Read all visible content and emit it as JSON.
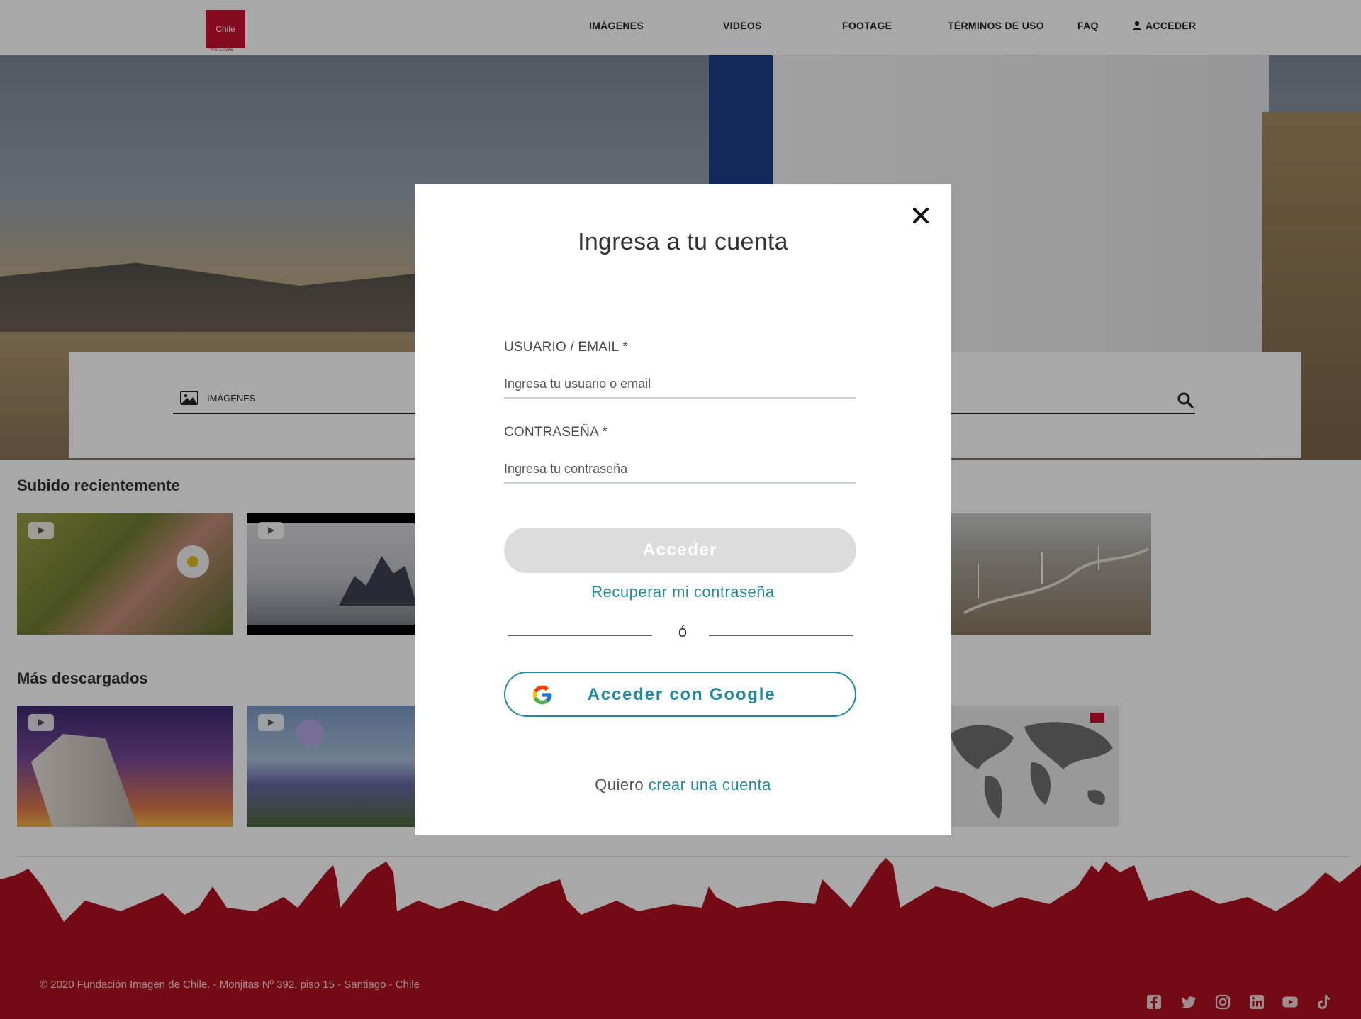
{
  "header": {
    "logo_text": "Chile",
    "logo_tagline": "WE CARE",
    "nav": [
      {
        "label": "IMÁGENES"
      },
      {
        "label": "VIDEOS"
      },
      {
        "label": "FOOTAGE"
      },
      {
        "label": "TÉRMINOS DE USO"
      },
      {
        "label": "FAQ"
      },
      {
        "label": "ACCEDER",
        "icon": "user-icon"
      }
    ]
  },
  "search": {
    "type_label": "IMÁGENES",
    "type_icon": "image-icon",
    "submit_icon": "search-icon"
  },
  "sections": {
    "recent_title": "Subido recientemente",
    "downloaded_title": "Más descargados"
  },
  "modal": {
    "title": "Ingresa a tu cuenta",
    "user_label": "USUARIO / EMAIL *",
    "user_placeholder": "Ingresa tu usuario o email",
    "password_label": "CONTRASEÑA *",
    "password_placeholder": "Ingresa tu contraseña",
    "submit_label": "Acceder",
    "recover_link": "Recuperar mi contraseña",
    "divider_text": "ó",
    "google_label": "Acceder con Google",
    "create_prefix": "Quiero",
    "create_link": "crear una cuenta",
    "close_icon": "close-icon"
  },
  "footer": {
    "copyright": "© 2020 Fundación Imagen de Chile. - Monjitas Nº 392, piso 15 - Santiago - Chile",
    "socials": [
      "facebook-icon",
      "twitter-icon",
      "instagram-icon",
      "linkedin-icon",
      "youtube-icon",
      "tiktok-icon"
    ]
  },
  "colors": {
    "brand_red": "#b0101f",
    "accent_teal": "#1f8a9e",
    "disabled_button": "#dcdcdc"
  }
}
